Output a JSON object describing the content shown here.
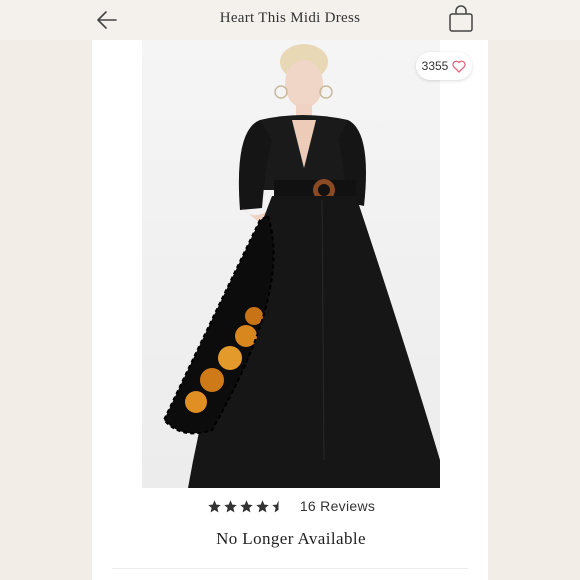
{
  "header": {
    "title": "Heart This Midi Dress",
    "back_icon": "arrow-left-icon",
    "bag_icon": "shopping-bag-icon"
  },
  "product": {
    "likes": "3355",
    "like_icon": "heart-outline-icon",
    "like_color": "#e2667f",
    "rating": 4.5,
    "rating_max": 5,
    "reviews_label": "16 Reviews",
    "availability": "No Longer Available"
  }
}
